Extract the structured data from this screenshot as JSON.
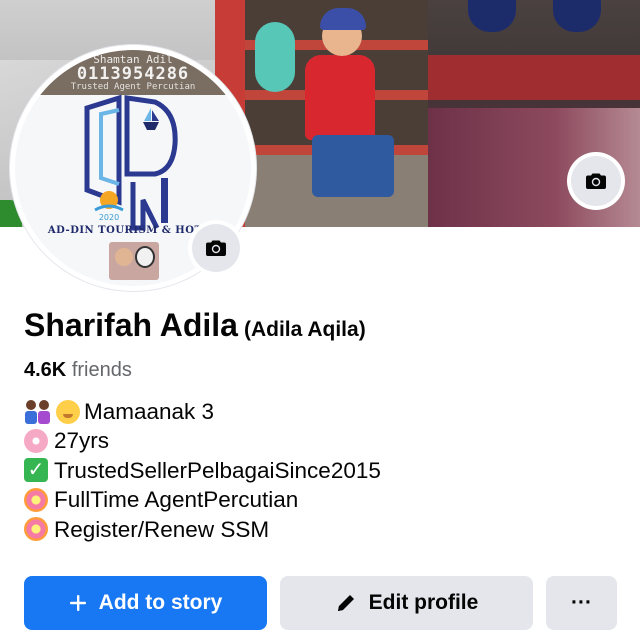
{
  "cover": {
    "camera_icon": "camera-icon"
  },
  "avatar": {
    "watermark_name": "Shamtan Adil",
    "watermark_phone": "0113954286",
    "watermark_tagline": "Trusted Agent Percutian",
    "brand_text": "AD-DIN TOURISM & HOTEL",
    "camera_icon": "camera-icon"
  },
  "profile": {
    "name": "Sharifah Adila",
    "nickname": "(Adila Aqila)",
    "friends_count": "4.6K",
    "friends_label": "friends"
  },
  "bio": [
    {
      "icon": "family-emoji-icon",
      "text": "Mamaanak 3"
    },
    {
      "icon": "cherry-blossom-emoji-icon",
      "text": "27yrs"
    },
    {
      "icon": "check-mark-emoji-icon",
      "text": "TrustedSellerPelbagaiSince2015"
    },
    {
      "icon": "flower-emoji-icon",
      "text": "FullTime AgentPercutian"
    },
    {
      "icon": "flower-emoji-icon",
      "text": "Register/Renew SSM"
    }
  ],
  "actions": {
    "add_story": "Add to story",
    "edit_profile": "Edit profile",
    "more": "···"
  },
  "colors": {
    "primary": "#1877f2",
    "secondary_button": "#e4e6eb",
    "text": "#050505",
    "muted_text": "#65676b"
  }
}
